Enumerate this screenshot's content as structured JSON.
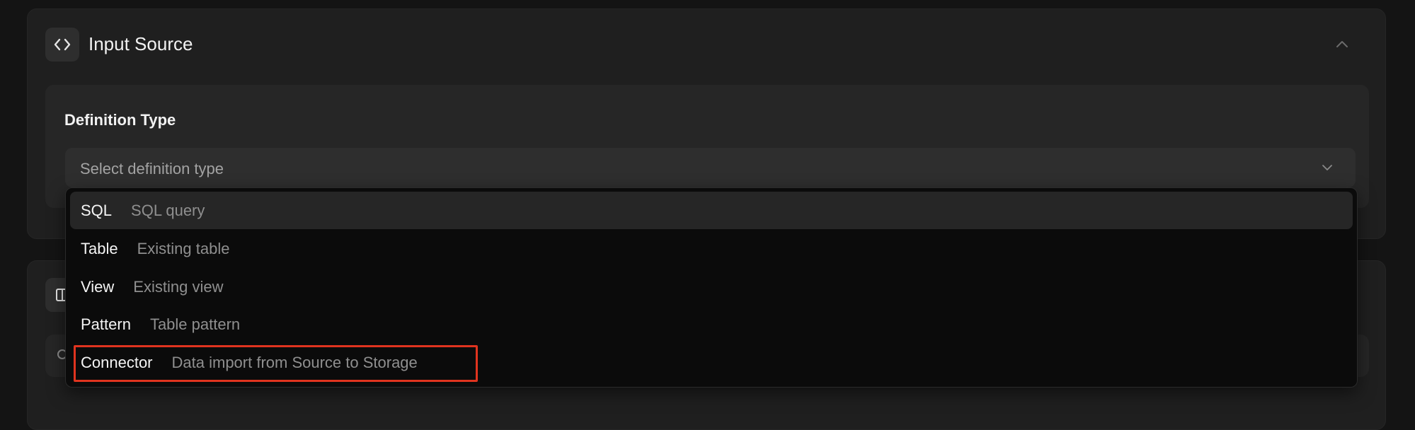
{
  "section": {
    "title": "Input Source",
    "icon": "code-icon"
  },
  "definition_type": {
    "label": "Definition Type",
    "placeholder": "Select definition type"
  },
  "dropdown": {
    "options": [
      {
        "label": "SQL",
        "description": "SQL query"
      },
      {
        "label": "Table",
        "description": "Existing table"
      },
      {
        "label": "View",
        "description": "Existing view"
      },
      {
        "label": "Pattern",
        "description": "Table pattern"
      },
      {
        "label": "Connector",
        "description": "Data import from Source to Storage"
      }
    ],
    "highlighted_index": 0,
    "annotated_index": 4
  },
  "colors": {
    "background": "#141414",
    "panel": "#1f1f1f",
    "dropdown": "#0b0b0b",
    "annotation": "#e0341f"
  }
}
